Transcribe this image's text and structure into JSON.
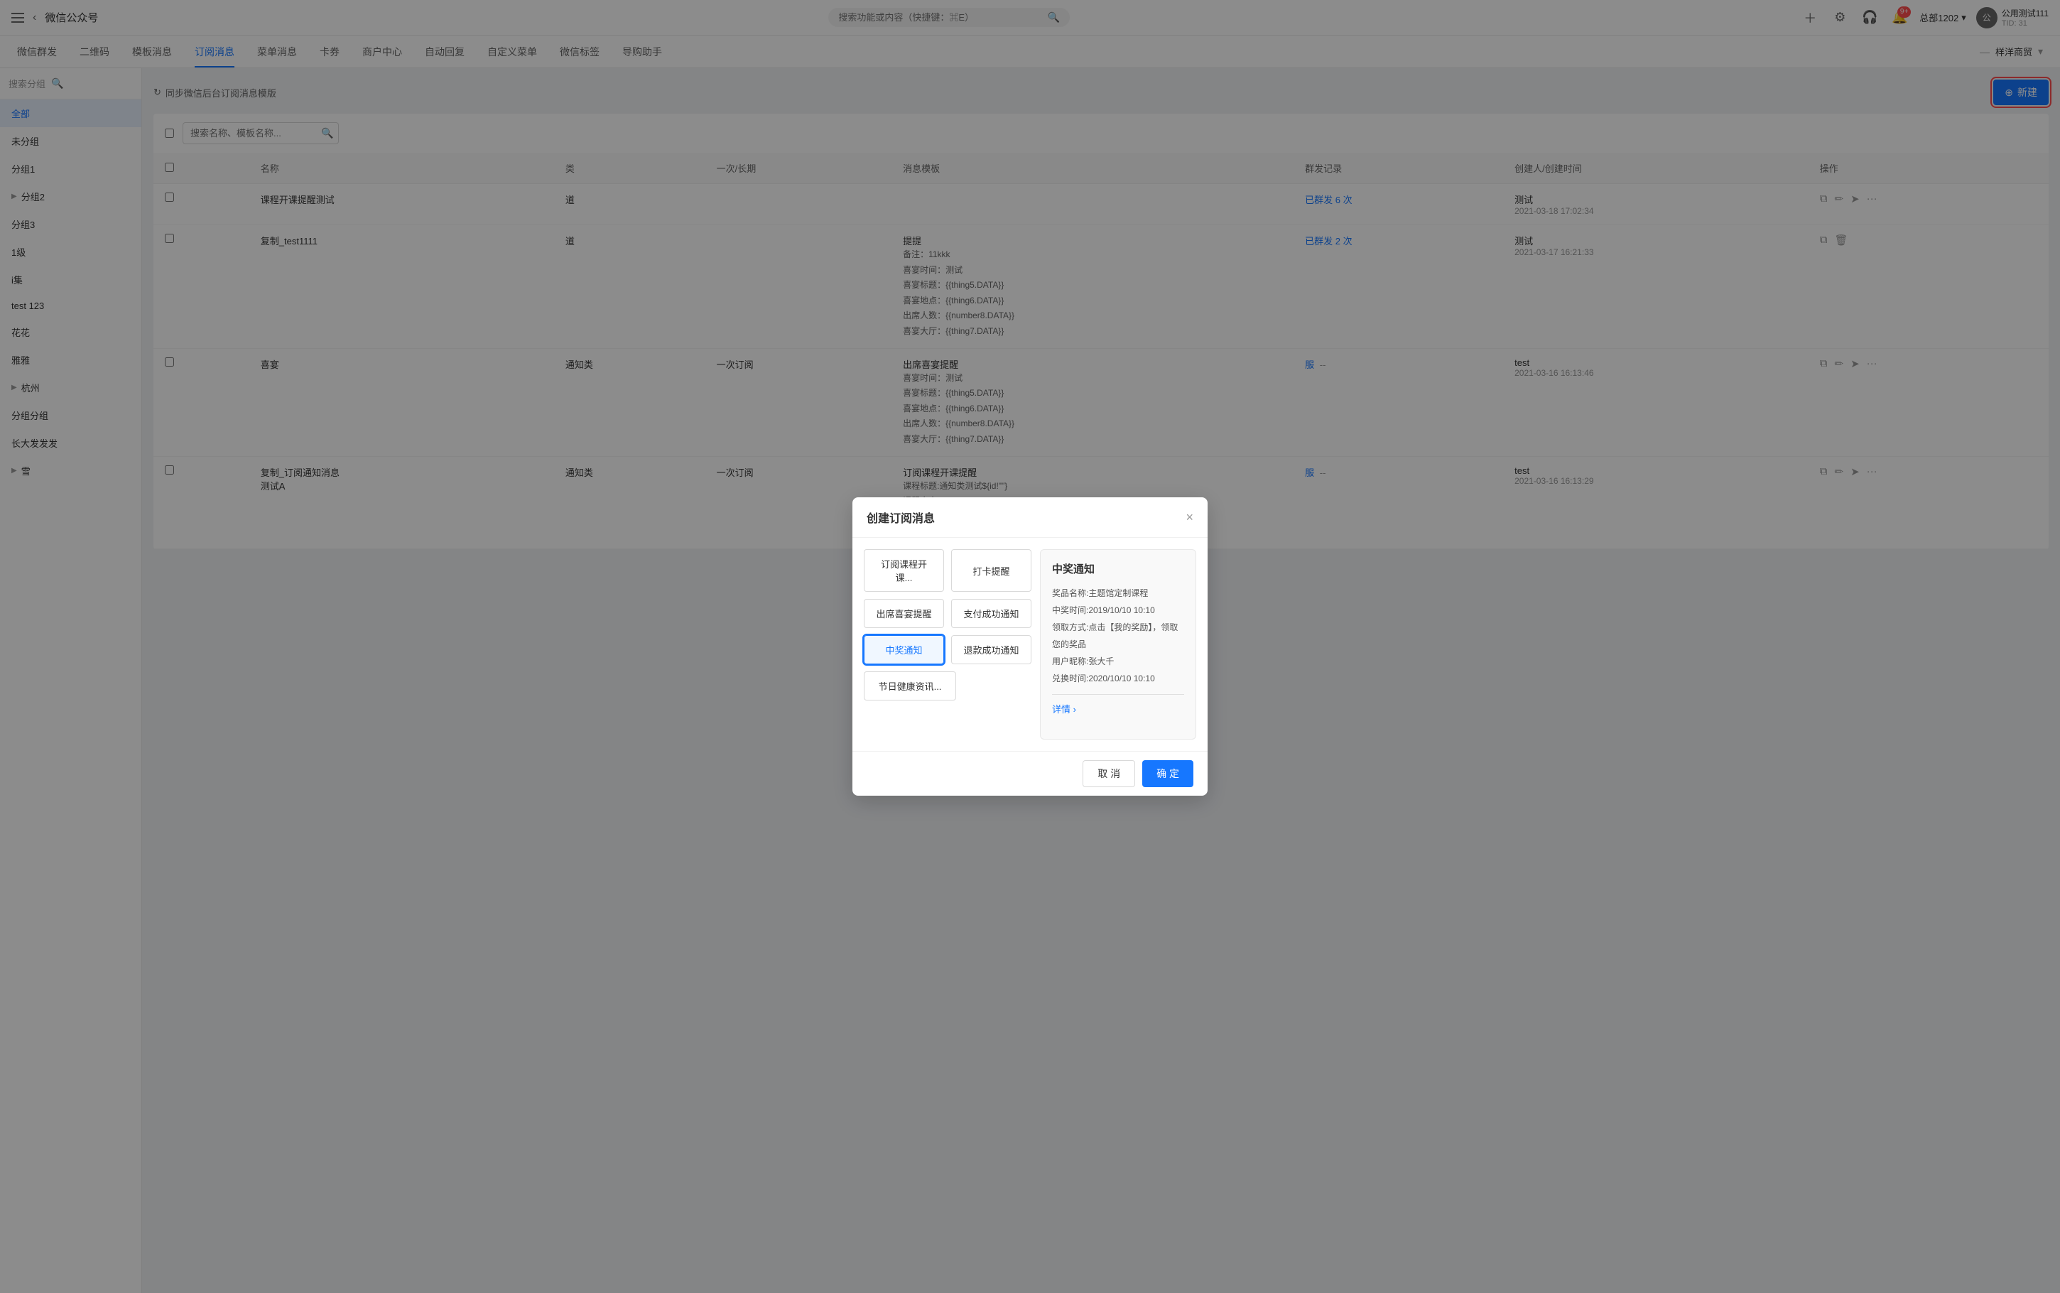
{
  "topbar": {
    "hamburger_label": "菜单",
    "back_label": "‹",
    "app_name": "微信公众号",
    "search_placeholder": "搜索功能或内容（快捷键：⌘E）",
    "badge_count": "9+",
    "total_label": "总部1202",
    "user_name": "公用测试111",
    "user_tid": "TID: 31"
  },
  "secnav": {
    "items": [
      {
        "label": "微信群发",
        "active": false
      },
      {
        "label": "二维码",
        "active": false
      },
      {
        "label": "模板消息",
        "active": false
      },
      {
        "label": "订阅消息",
        "active": true
      },
      {
        "label": "菜单消息",
        "active": false
      },
      {
        "label": "卡券",
        "active": false
      },
      {
        "label": "商户中心",
        "active": false
      },
      {
        "label": "自动回复",
        "active": false
      },
      {
        "label": "自定义菜单",
        "active": false
      },
      {
        "label": "微信标签",
        "active": false
      },
      {
        "label": "导购助手",
        "active": false
      }
    ],
    "right_label": "样洋商贸"
  },
  "sidebar": {
    "search_placeholder": "搜索分组",
    "items": [
      {
        "label": "全部",
        "active": true,
        "indent": false,
        "arrow": false
      },
      {
        "label": "未分组",
        "active": false,
        "indent": false,
        "arrow": false
      },
      {
        "label": "分组1",
        "active": false,
        "indent": false,
        "arrow": false
      },
      {
        "label": "分组2",
        "active": false,
        "indent": false,
        "arrow": true
      },
      {
        "label": "分组3",
        "active": false,
        "indent": false,
        "arrow": false
      },
      {
        "label": "1级",
        "active": false,
        "indent": false,
        "arrow": false
      },
      {
        "label": "i集",
        "active": false,
        "indent": false,
        "arrow": false
      },
      {
        "label": "test 123",
        "active": false,
        "indent": false,
        "arrow": false
      },
      {
        "label": "花花",
        "active": false,
        "indent": false,
        "arrow": false
      },
      {
        "label": "雅雅",
        "active": false,
        "indent": false,
        "arrow": false
      },
      {
        "label": "杭州",
        "active": false,
        "indent": false,
        "arrow": true
      },
      {
        "label": "分组分组",
        "active": false,
        "indent": false,
        "arrow": false
      },
      {
        "label": "长大发发发",
        "active": false,
        "indent": false,
        "arrow": false
      },
      {
        "label": "雪",
        "active": false,
        "indent": false,
        "arrow": true
      }
    ]
  },
  "content": {
    "sync_btn": "同步微信后台订阅消息模版",
    "new_btn": "新建",
    "table_search_placeholder": "搜索名称、模板名称...",
    "table_headers": [
      "名称",
      "类",
      "一次/长期",
      "消息模板",
      "群发记录",
      "创建人/创建时间",
      "操作"
    ],
    "rows": [
      {
        "name": "课程开课提醒测试",
        "type": "道",
        "freq": "",
        "template": "",
        "sent": "已群发 6 次",
        "creator": "测试",
        "created_time": "2021-03-18 17:02:34"
      },
      {
        "name": "复制_test1111",
        "type": "道",
        "freq": "",
        "template": "提提",
        "note": "备注：11kkk",
        "banquet_time": "喜宴时间：测试",
        "banquet_title": "喜宴标题：{{thing5.DATA}}",
        "banquet_addr": "喜宴地点：{{thing6.DATA}}",
        "guests": "出席人数：{{number8.DATA}}",
        "banquet_hall": "喜宴大厅：{{thing7.DATA}}",
        "sent": "已群发 2 次",
        "creator": "测试",
        "created_time": "2021-03-17 16:21:33"
      },
      {
        "name": "喜宴",
        "type": "通知类",
        "freq": "一次订阅",
        "template": "出席喜宴提醒",
        "detail": "喜宴时间：测试\n喜宴标题：{{thing5.DATA}}\n喜宴地点：{{thing6.DATA}}\n出席人数：{{number8.DATA}}\n喜宴大厅：{{thing7.DATA}}",
        "sent": "--",
        "sent_link": "服",
        "creator": "test",
        "created_time": "2021-03-16 16:13:46"
      },
      {
        "name": "复制_订阅通知消息\n测试A",
        "type": "通知类",
        "freq": "一次订阅",
        "template": "订阅课程开课提醒",
        "detail": "课程标题:通知类测试${id!\"\"}\n课程内容:${name!\"\"}\n时间:${date}\n课程进度:${now}",
        "sent": "--",
        "sent_link": "服",
        "creator": "test",
        "created_time": "2021-03-16 16:13:29"
      }
    ]
  },
  "modal": {
    "title": "创建订阅消息",
    "close_label": "×",
    "buttons": [
      {
        "label": "订阅课程开课...",
        "selected": false
      },
      {
        "label": "打卡提醒",
        "selected": false
      },
      {
        "label": "出席喜宴提醒",
        "selected": false
      },
      {
        "label": "支付成功通知",
        "selected": false
      },
      {
        "label": "中奖通知",
        "selected": true
      },
      {
        "label": "退款成功通知",
        "selected": false
      },
      {
        "label": "节日健康资讯...",
        "selected": false
      }
    ],
    "preview": {
      "title": "中奖通知",
      "lines": [
        "奖品名称:主题馆定制课程",
        "中奖时间:2019/10/10 10:10",
        "领取方式:点击【我的奖励】，领取您的奖品",
        "用户昵称:张大千",
        "兑换时间:2020/10/10 10:10"
      ],
      "link": "详情 ›"
    },
    "cancel_btn": "取 消",
    "confirm_btn": "确 定"
  }
}
